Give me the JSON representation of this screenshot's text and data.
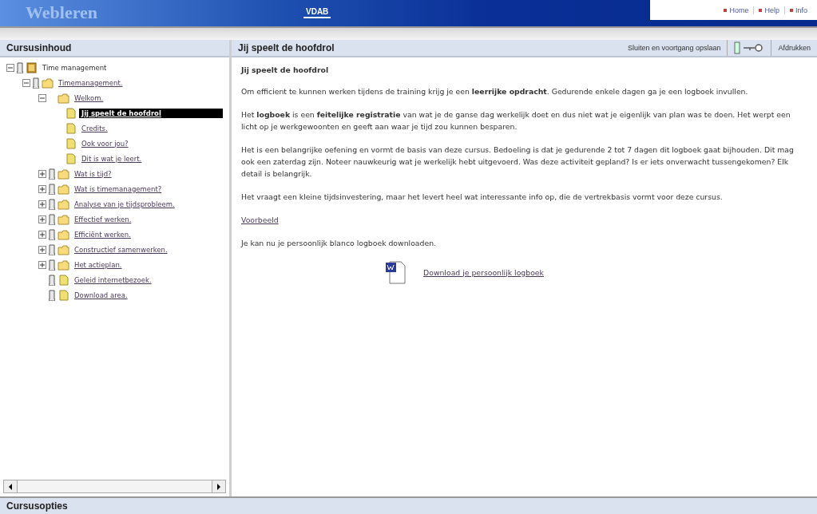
{
  "header": {
    "logo": "Webleren",
    "brand": "VDAB",
    "links": [
      {
        "label": "Home"
      },
      {
        "label": "Help"
      },
      {
        "label": "Info"
      }
    ]
  },
  "sidebar": {
    "title": "Cursusinhoud",
    "tree": [
      {
        "label": "Time management",
        "kind": "book",
        "expanded": true,
        "status_icon": true,
        "link": false,
        "selected": false,
        "children": [
          {
            "label": "Timemanagement.",
            "kind": "folder",
            "expanded": true,
            "status_icon": true,
            "link": true,
            "selected": false,
            "children": [
              {
                "label": "Welkom.",
                "kind": "folder",
                "expanded": true,
                "status_icon": false,
                "link": true,
                "selected": false,
                "children": [
                  {
                    "label": "Jij speelt de hoofdrol",
                    "kind": "page",
                    "status_icon": false,
                    "link": true,
                    "selected": true
                  },
                  {
                    "label": "Credits.",
                    "kind": "page",
                    "status_icon": false,
                    "link": true,
                    "selected": false
                  },
                  {
                    "label": "Ook voor jou?",
                    "kind": "page",
                    "status_icon": false,
                    "link": true,
                    "selected": false
                  },
                  {
                    "label": "Dit is wat je leert.",
                    "kind": "page",
                    "status_icon": false,
                    "link": true,
                    "selected": false
                  }
                ]
              },
              {
                "label": "Wat is tijd?",
                "kind": "folder",
                "expanded": false,
                "status_icon": true,
                "link": true,
                "selected": false
              },
              {
                "label": "Wat is timemanagement?",
                "kind": "folder",
                "expanded": false,
                "status_icon": true,
                "link": true,
                "selected": false
              },
              {
                "label": "Analyse van je tijdsprobleem.",
                "kind": "folder",
                "expanded": false,
                "status_icon": true,
                "link": true,
                "selected": false
              },
              {
                "label": "Effectief werken.",
                "kind": "folder",
                "expanded": false,
                "status_icon": true,
                "link": true,
                "selected": false
              },
              {
                "label": "Efficiënt werken.",
                "kind": "folder",
                "expanded": false,
                "status_icon": true,
                "link": true,
                "selected": false
              },
              {
                "label": "Constructief samenwerken.",
                "kind": "folder",
                "expanded": false,
                "status_icon": true,
                "link": true,
                "selected": false
              },
              {
                "label": "Het actieplan.",
                "kind": "folder",
                "expanded": false,
                "status_icon": true,
                "link": true,
                "selected": false
              },
              {
                "label": "Geleid internetbezoek.",
                "kind": "page",
                "status_icon": true,
                "link": true,
                "selected": false
              },
              {
                "label": "Download area.",
                "kind": "page",
                "status_icon": true,
                "link": true,
                "selected": false
              }
            ]
          }
        ]
      }
    ]
  },
  "content": {
    "title": "Jij speelt de hoofdrol",
    "close_label": "Sluiten en voortgang opslaan",
    "print_label": "Afdrukken",
    "heading": "Jij speelt de hoofdrol",
    "blocks": [
      {
        "kind": "paragraph",
        "text": "Om efficient te kunnen werken tijdens de training krijg je een **leerrijke opdracht**. Gedurende enkele dagen ga je een logboek invullen."
      },
      {
        "kind": "paragraph",
        "text": "Het **logboek** is een **feitelijke registratie** van wat je de ganse dag werkelijk doet en dus niet wat je eigenlijk van plan was te doen. Het werpt een licht op je werkgewoonten en geeft aan waar je tijd zou kunnen besparen."
      },
      {
        "kind": "paragraph",
        "text": "Het is een belangrijke oefening en vormt de basis van deze cursus. Bedoeling is dat je gedurende 2 tot 7 dagen dit logboek gaat bijhouden. Dit mag ook een zaterdag zijn. Noteer nauwkeurig wat je werkelijk hebt uitgevoerd. Was deze activiteit gepland? Is er iets onverwacht tussengekomen? Elk detail is belangrijk."
      },
      {
        "kind": "paragraph",
        "text": "Het vraagt een kleine tijdsinvestering, maar het levert heel wat interessante info op, die de vertrekbasis vormt voor deze cursus."
      },
      {
        "kind": "link",
        "text": "Voorbeeld"
      },
      {
        "kind": "paragraph",
        "text": "Je kan nu je persoonlijk blanco logboek downloaden."
      },
      {
        "kind": "download",
        "text": "Download je persoonlijk logboek"
      }
    ]
  },
  "footer": {
    "title": "Cursusopties"
  }
}
